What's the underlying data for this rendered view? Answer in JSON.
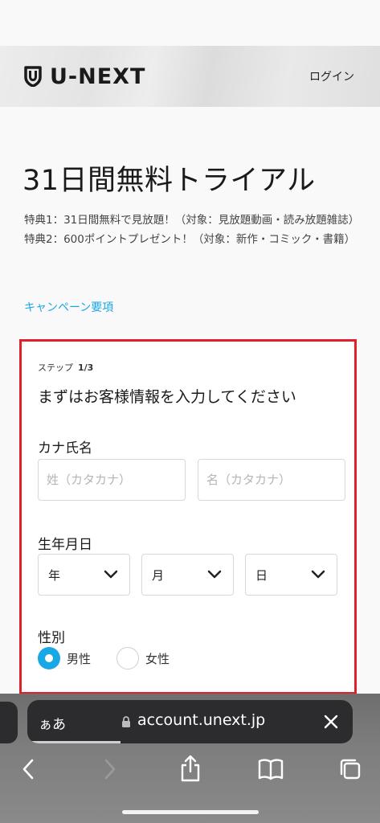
{
  "header": {
    "logo_text": "U-NEXT",
    "login_label": "ログイン"
  },
  "page": {
    "title": "31日間無料トライアル",
    "benefits": [
      "特典1：31日間無料で見放題！（対象：見放題動画・読み放題雑誌）",
      "特典2：600ポイントプレゼント！（対象：新作・コミック・書籍）"
    ],
    "campaign_link": "キャンペーン要項"
  },
  "form": {
    "step_label": "ステップ",
    "step_count": "1/3",
    "heading": "まずはお客様情報を入力してください",
    "kana_name": {
      "label": "カナ氏名",
      "last_name_placeholder": "姓（カタカナ）",
      "first_name_placeholder": "名（カタカナ）"
    },
    "birthdate": {
      "label": "生年月日",
      "year_value": "年",
      "month_value": "月",
      "day_value": "日"
    },
    "gender": {
      "label": "性別",
      "options": [
        {
          "label": "男性",
          "selected": true
        },
        {
          "label": "女性",
          "selected": false
        }
      ]
    }
  },
  "browser": {
    "aa_label": "ぁあ",
    "url": "account.unext.jp",
    "icons": [
      "lock-icon",
      "close-icon",
      "back-icon",
      "forward-icon",
      "share-icon",
      "bookmarks-icon",
      "tabs-icon"
    ]
  },
  "colors": {
    "accent": "#1aa7e6",
    "highlight_border": "#e0202a",
    "browser_bar": "#2c2c2e"
  }
}
